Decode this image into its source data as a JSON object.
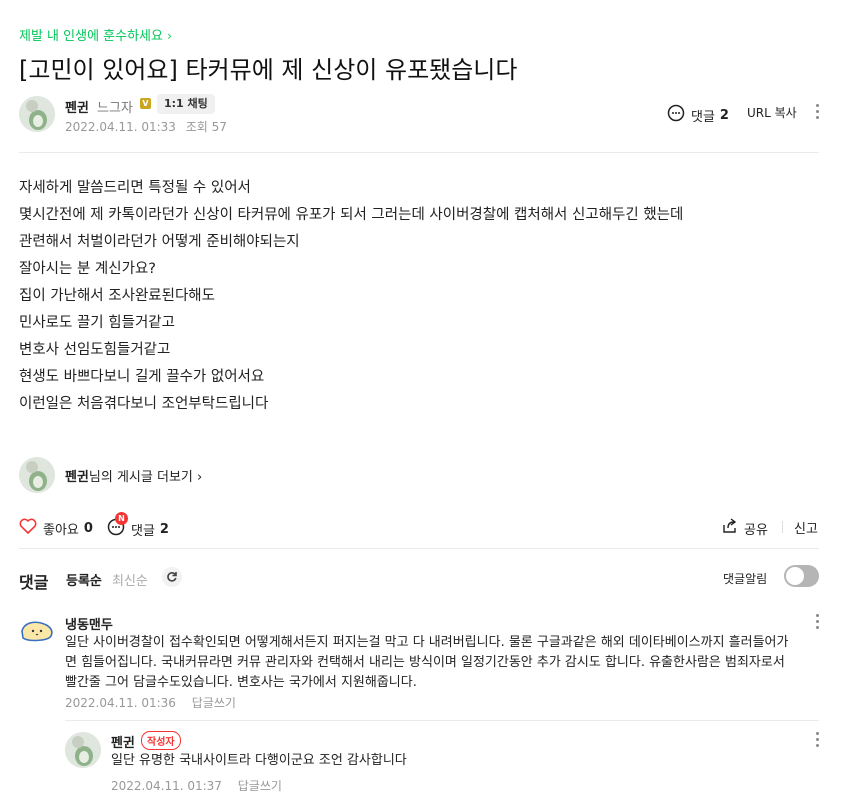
{
  "breadcrumb": {
    "label": "제발 내 인생에 훈수하세요",
    "chevron": "chevron-right-icon"
  },
  "post": {
    "title": "[고민이 있어요] 타커뮤에 제 신상이 유포됐습니다",
    "author": {
      "nickname": "펜귄",
      "level_label": "느그자",
      "level_badge": "V",
      "chat_button": "1:1 채팅"
    },
    "date": "2022.04.11. 01:33",
    "views_label": "조회 57",
    "comment_label": "댓글",
    "comment_count": "2",
    "url_copy_label": "URL 복사",
    "body_lines": [
      "자세하게 말씀드리면 특정될 수 있어서",
      "몇시간전에 제 카톡이라던가 신상이 타커뮤에 유포가 되서 그러는데 사이버경찰에 캡처해서 신고해두긴 했는데",
      "관련해서 처벌이라던가 어떻게 준비해야되는지",
      "잘아시는 분 계신가요?",
      "집이 가난해서 조사완료된다해도",
      "민사로도 끌기 힘들거같고",
      "변호사 선임도힘들거같고",
      "현생도 바쁘다보니 길게 끌수가 없어서요",
      "이런일은 처음겪다보니 조언부탁드립니다"
    ],
    "more_posts": {
      "nickname": "펜귄",
      "suffix": "님의 게시글 더보기"
    }
  },
  "actions": {
    "like_label": "좋아요",
    "like_count": "0",
    "comment_label": "댓글",
    "comment_count": "2",
    "new_badge": "N",
    "share_label": "공유",
    "report_label": "신고"
  },
  "comments_header": {
    "title": "댓글",
    "sort_register": "등록순",
    "sort_latest": "최신순",
    "alarm_label": "댓글알림",
    "alarm_on": false
  },
  "comments": [
    {
      "nickname": "냉동맨두",
      "text": "일단 사이버경찰이 접수확인되면 어떻게해서든지 퍼지는걸 막고 다 내려버립니다. 물론 구글과같은 해외 데이타베이스까지 흘러들어가면 힘들어집니다. 국내커뮤라면 커뮤 관리자와 컨택해서 내리는 방식이며 일정기간동안 추가 감시도 합니다. 유출한사람은 범죄자로서 빨간줄 그어 담글수도있습니다. 변호사는 국가에서 지원해줍니다.",
      "date": "2022.04.11. 01:36",
      "reply_label": "답글쓰기"
    },
    {
      "nickname": "펜귄",
      "author_tag": "작성자",
      "text": "일단 유명한 국내사이트라 다행이군요 조언 감사합니다",
      "date": "2022.04.11. 01:37",
      "reply_label": "답글쓰기"
    }
  ],
  "colors": {
    "accent_green": "#03c75a",
    "new_badge_red": "#f53535",
    "level_gold": "#c9a521"
  }
}
